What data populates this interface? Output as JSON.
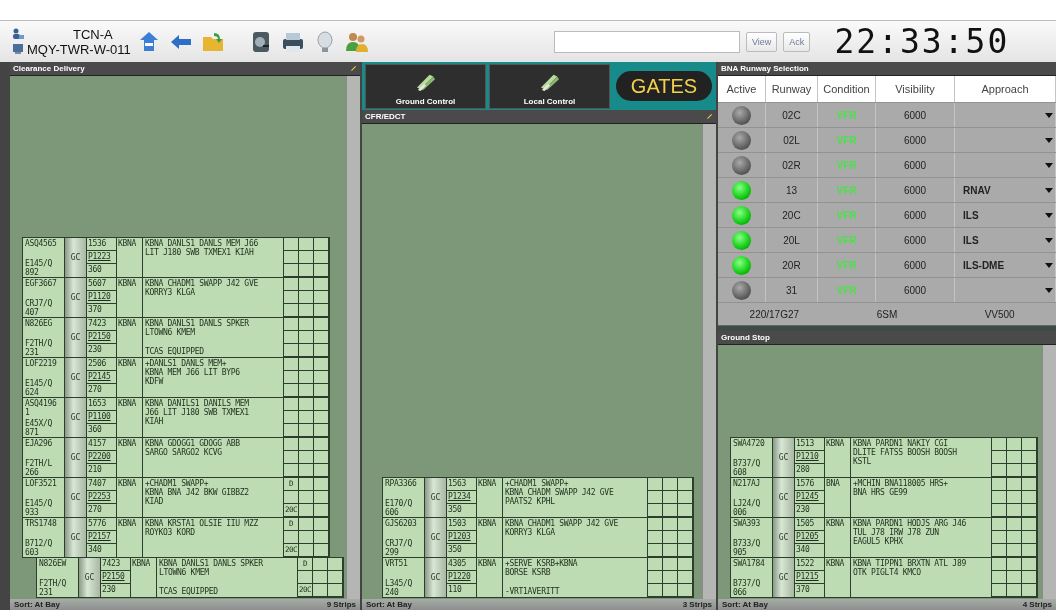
{
  "toolbar": {
    "position": "TCN-A",
    "workstation": "MQY-TWR-W-011",
    "buttons": [
      "View",
      "Ack"
    ],
    "clock": "22:33:50"
  },
  "clearance_delivery": {
    "title": "Clearance Delivery",
    "strips": [
      {
        "callsign": "ASQ4565",
        "aircraft": "E145/Q",
        "cid": "892",
        "controller": "GC",
        "beacon": "1536",
        "proposed": "P1223",
        "altitude": "360",
        "departure": "KBNA",
        "route": [
          "KBNA DANLS1 DANLS MEM J66",
          "LIT J180 SWB TXMEX1 KIAH"
        ]
      },
      {
        "callsign": "EGF3667",
        "aircraft": "CRJ7/Q",
        "cid": "407",
        "controller": "GC",
        "beacon": "5607",
        "proposed": "P1120",
        "altitude": "370",
        "departure": "KBNA",
        "route": [
          "KBNA CHADM1 SWAPP J42 GVE",
          "KORRY3 KLGA"
        ]
      },
      {
        "callsign": "N826EG",
        "aircraft": "F2TH/Q",
        "cid": "231",
        "controller": "GC",
        "beacon": "7423",
        "proposed": "P2150",
        "altitude": "230",
        "departure": "KBNA",
        "route": [
          "KBNA DANLS1 DANLS SPKER",
          "LTOWN6 KMEM"
        ],
        "remark": "TCAS EQUIPPED"
      },
      {
        "callsign": "LOF2219",
        "aircraft": "E145/Q",
        "cid": "624",
        "controller": "GC",
        "beacon": "2506",
        "proposed": "P2145",
        "altitude": "270",
        "departure": "KBNA",
        "route": [
          "+DANLS1 DANLS MEM+",
          "KBNA MEM J66 LIT BYP6",
          "KDFW"
        ]
      },
      {
        "callsign": "ASQ4196",
        "line_2": "1",
        "aircraft": "E45X/Q",
        "cid": "871",
        "controller": "GC",
        "beacon": "1653",
        "proposed": "P1100",
        "altitude": "360",
        "departure": "KBNA",
        "route": [
          "KBNA DANILS1 DANILS MEM",
          "J66 LIT J180 SWB TXMEX1",
          "KIAH"
        ]
      },
      {
        "callsign": "EJA296",
        "aircraft": "F2TH/L",
        "cid": "266",
        "controller": "GC",
        "beacon": "4157",
        "proposed": "P2200",
        "altitude": "210",
        "departure": "KBNA",
        "route": [
          "KBNA GDOGG1 GDOGG ABB",
          "SARGO SARGO2 KCVG"
        ]
      },
      {
        "callsign": "LOF3521",
        "aircraft": "E145/Q",
        "cid": "933",
        "controller": "GC",
        "beacon": "7407",
        "proposed": "P2253",
        "altitude": "270",
        "departure": "KBNA",
        "route": [
          "+CHADM1 SWAPP+",
          "KBNA BNA J42 BKW GIBBZ2",
          "KIAD"
        ],
        "flag": "D",
        "runway": "20C"
      },
      {
        "callsign": "TRS1748",
        "aircraft": "B712/Q",
        "cid": "603",
        "controller": "GC",
        "beacon": "5776",
        "proposed": "P2157",
        "altitude": "340",
        "departure": "KBNA",
        "route": [
          "KBNA KRSTA1 OLSIE IIU MZZ",
          "ROYKO3 KORD"
        ],
        "flag": "D",
        "runway": "20C"
      },
      {
        "callsign": "N826EW",
        "aircraft": "F2TH/Q",
        "cid": "231",
        "controller": "GC",
        "beacon": "7423",
        "proposed": "P2150",
        "altitude": "230",
        "departure": "KBNA",
        "route": [
          "KBNA DANLS1 DANLS SPKER",
          "LTOWN6 KMEM"
        ],
        "remark": "TCAS EQUIPPED",
        "flag": "D",
        "runway": "20C",
        "shifted": true
      }
    ],
    "status": {
      "sort": "Sort: At Bay",
      "count": "9 Strips"
    }
  },
  "bays": {
    "tabs": [
      {
        "label": "Ground Control"
      },
      {
        "label": "Local Control"
      }
    ],
    "gates_button": "GATES"
  },
  "cfr_edct": {
    "title": "CFR/EDCT",
    "strips": [
      {
        "callsign": "RPA3366",
        "aircraft": "E170/Q",
        "cid": "606",
        "controller": "GC",
        "beacon": "1563",
        "proposed": "P1234",
        "altitude": "350",
        "departure": "KBNA",
        "route": [
          "+CHADM1 SWAPP+",
          "KBNA CHADM SWAPP J42 GVE",
          "PAATS2 KPHL"
        ]
      },
      {
        "callsign": "GJS6203",
        "aircraft": "CRJ7/Q",
        "cid": "299",
        "controller": "GC",
        "beacon": "1503",
        "proposed": "P1203",
        "altitude": "350",
        "departure": "KBNA",
        "route": [
          "KBNA CHADM1 SWAPP J42 GVE",
          "KORRY3 KLGA"
        ]
      },
      {
        "callsign": "VRT51",
        "aircraft": "L345/Q",
        "cid": "240",
        "controller": "GC",
        "beacon": "4305",
        "proposed": "P1220",
        "altitude": "110",
        "departure": "KBNA",
        "route": [
          "+SERVE KSRB+KBNA",
          "BORSE KSRB"
        ],
        "remark": "-VRT1AVERITT"
      }
    ],
    "status": {
      "sort": "Sort: At Bay",
      "count": "3 Strips"
    }
  },
  "runway_selection": {
    "title": "BNA Runway Selection",
    "columns": [
      "Active",
      "Runway",
      "Condition",
      "Visibility",
      "Approach"
    ],
    "rows": [
      {
        "active": false,
        "runway": "02C",
        "condition": "VFR",
        "visibility": "6000"
      },
      {
        "active": false,
        "runway": "02L",
        "condition": "VFR",
        "visibility": "6000"
      },
      {
        "active": false,
        "runway": "02R",
        "condition": "VFR",
        "visibility": "6000"
      },
      {
        "active": true,
        "runway": "13",
        "condition": "VFR",
        "visibility": "6000",
        "approach": "RNAV"
      },
      {
        "active": true,
        "runway": "20C",
        "condition": "VFR",
        "visibility": "6000",
        "approach": "ILS"
      },
      {
        "active": true,
        "runway": "20L",
        "condition": "VFR",
        "visibility": "6000",
        "approach": "ILS"
      },
      {
        "active": true,
        "runway": "20R",
        "condition": "VFR",
        "visibility": "6000",
        "approach": "ILS-DME"
      },
      {
        "active": false,
        "runway": "31",
        "condition": "VFR",
        "visibility": "6000"
      }
    ],
    "footer": [
      "220/17G27",
      "6SM",
      "VV500"
    ]
  },
  "ground_stop": {
    "title": "Ground Stop",
    "strips": [
      {
        "callsign": "SWA4720",
        "aircraft": "B737/Q",
        "cid": "608",
        "controller": "GC",
        "beacon": "1513",
        "proposed": "P1210",
        "altitude": "280",
        "departure": "KBNA",
        "route": [
          "KBNA PARDN1 NAKIY CGI",
          "DLITE FATSS BOOSH BOOSH",
          "KSTL"
        ]
      },
      {
        "callsign": "N217AJ",
        "aircraft": "LJ24/Q",
        "cid": "006",
        "controller": "GC",
        "beacon": "1576",
        "proposed": "P1245",
        "altitude": "230",
        "departure": "BNA",
        "route": [
          "+MCHIN BNA118005 HRS+",
          "BNA HRS GE99"
        ]
      },
      {
        "callsign": "SWA393",
        "aircraft": "B733/Q",
        "cid": "905",
        "controller": "GC",
        "beacon": "1505",
        "proposed": "P1205",
        "altitude": "340",
        "departure": "KBNA",
        "route": [
          "KBNA PARDN1 HODJS ARG J46",
          "TUL J78 IRW J78 ZUN",
          "EAGUL5 KPHX"
        ]
      },
      {
        "callsign": "SWA1784",
        "aircraft": "B737/Q",
        "cid": "066",
        "controller": "GC",
        "beacon": "1522",
        "proposed": "P1215",
        "altitude": "370",
        "departure": "KBNA",
        "route": [
          "KBNA TIPPN1 BRXTN ATL J89",
          "OTK PIGLT4 KMCO"
        ]
      }
    ],
    "status": {
      "sort": "Sort: At Bay",
      "count": "4 Strips"
    }
  }
}
